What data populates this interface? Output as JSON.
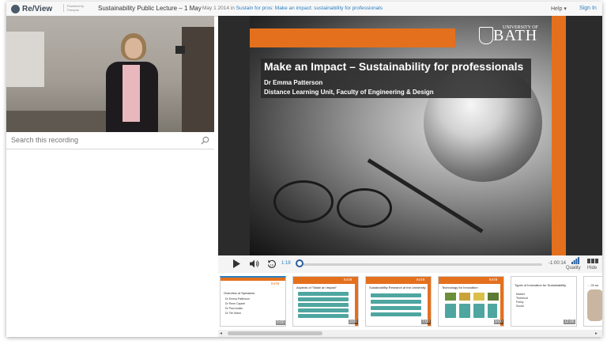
{
  "header": {
    "logo_text": "Re/View",
    "powered_by": "Powered by Panopto",
    "session_title": "Sustainability Public Lecture – 1 May",
    "date": "May 1 2014",
    "in_label": "in",
    "folder": "Sustain for pros: Make an impact: sustainability for professionals",
    "help_label": "Help ▾",
    "signin_label": "Sign In"
  },
  "search": {
    "placeholder": "Search this recording"
  },
  "slide": {
    "logo_top": "UNIVERSITY OF",
    "logo": "BATH",
    "title": "Make an Impact – Sustainability for professionals",
    "author": "Dr Emma Patterson",
    "unit": "Distance Learning Unit, Faculty of Engineering & Design"
  },
  "controls": {
    "current_time": "1:18",
    "remaining_time": "-1:00:14",
    "position_fraction": 0.0,
    "quality_label": "Quality",
    "hide_label": "Hide",
    "play_icon": "play-icon",
    "volume_icon": "volume-icon",
    "rewind_icon": "rewind-10-icon"
  },
  "thumbnails": [
    {
      "title": "Overview of Speakers",
      "lines": [
        "Dr Emma Patterson",
        "Dr Rene Capeel",
        "Dr Paul Austin",
        "Dr Tim Mann"
      ],
      "time": "0:00"
    },
    {
      "title": "Aspects of \"Make an Impact\"",
      "lines": [],
      "time": "3:00"
    },
    {
      "title": "Sustainability Research at the University",
      "lines": [],
      "time": "7:00"
    },
    {
      "title": "Technology for Innovation",
      "lines": [],
      "time": "9:00"
    },
    {
      "title": "Types of Innovation for Sustainability",
      "lines": [
        "Market",
        "Technical",
        "Policy",
        "Social"
      ],
      "time": "12:00"
    },
    {
      "title": "... Or so",
      "lines": [],
      "time": ""
    }
  ],
  "colors": {
    "accent_orange": "#e4701e",
    "link_blue": "#2a7fc1",
    "teal": "#4fa6a0"
  }
}
